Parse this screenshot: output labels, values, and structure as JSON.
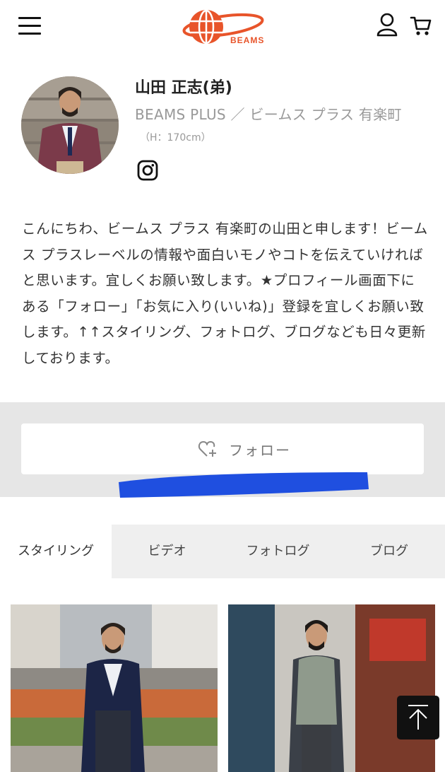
{
  "header": {
    "logo_text": "BEAMS",
    "menu_icon": "hamburger-menu-icon",
    "account_icon": "user-icon",
    "cart_icon": "shopping-cart-icon"
  },
  "profile": {
    "name": "山田 正志(弟)",
    "brand_shop": "BEAMS PLUS ／ ビームス プラス 有楽町",
    "height": "（H：170cm）",
    "social_icon": "instagram-icon",
    "bio": "こんにちわ、ビームス プラス 有楽町の山田と申します！ビームス プラスレーベルの情報や面白いモノやコトを伝えていければと思います。宜しくお願い致します。★プロフィール画面下にある「フォロー」「お気に入り(いいね)」登録を宜しくお願い致します。↑↑スタイリング、フォトログ、ブログなども日々更新しております。"
  },
  "follow": {
    "label": "フォロー",
    "icon": "heart-plus-icon"
  },
  "tabs": [
    {
      "label": "スタイリング",
      "active": true
    },
    {
      "label": "ビデオ",
      "active": false
    },
    {
      "label": "フォトログ",
      "active": false
    },
    {
      "label": "ブログ",
      "active": false
    }
  ],
  "scroll_top_icon": "arrow-up-icon",
  "colors": {
    "brand_orange": "#e8542a",
    "follow_band": "#e6e6e6",
    "tab_bar": "#efefef",
    "annotation_blue": "#1f4fe0"
  }
}
